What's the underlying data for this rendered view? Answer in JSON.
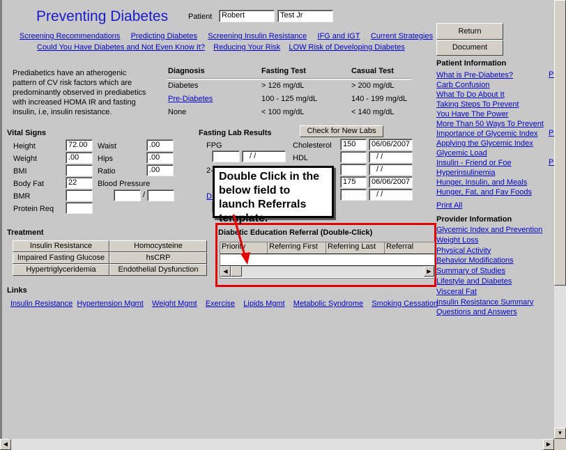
{
  "title": "Preventing Diabetes",
  "patient": {
    "label": "Patient",
    "first": "Robert",
    "last": "Test Jr"
  },
  "top_links_row1": [
    "Screening Recommendations",
    "Predicting Diabetes",
    "Screening Insulin Resistance",
    "IFG and IGT",
    "Current Strategies"
  ],
  "top_links_row2": [
    "Could You Have Diabetes and Not Even Know It?",
    "Reducing Your Risk",
    "LOW Risk of Developing Diabetes"
  ],
  "description": [
    "Prediabetics  have an atherogenic",
    "pattern of CV risk factors which are",
    "predominantly observed in prediabetics",
    "with increased HOMA IR and fasting",
    "insulin, i.e, insulin resistance."
  ],
  "diagnosis_table": {
    "headers": [
      "Diagnosis",
      "Fasting Test",
      "Casual Test"
    ],
    "rows": [
      [
        "Diabetes",
        "> 126 mg/dL",
        "> 200 mg/dL"
      ],
      [
        "Pre-Diabetes",
        "100 - 125 mg/dL",
        "140 - 199 mg/dL"
      ],
      [
        "None",
        "< 100 mg/dL",
        "< 140 mg/dL"
      ]
    ]
  },
  "vitals": {
    "title": "Vital Signs",
    "left": [
      {
        "label": "Height",
        "value": "72.00"
      },
      {
        "label": "Weight",
        "value": ".00"
      },
      {
        "label": "BMI",
        "value": ""
      },
      {
        "label": "Body Fat",
        "value": "22"
      },
      {
        "label": "BMR",
        "value": ""
      },
      {
        "label": "Protein Req",
        "value": ""
      }
    ],
    "right": [
      {
        "label": "Waist",
        "value": ".00"
      },
      {
        "label": "Hips",
        "value": ".00"
      },
      {
        "label": "Ratio",
        "value": ".00"
      }
    ],
    "bp_label": "Blood Pressure",
    "bp_sep": "/"
  },
  "labs": {
    "title": "Fasting Lab Results",
    "check_button": "Check for New Labs",
    "fpg_label": "FPG",
    "fpg_date": " / /",
    "two_label": "2-",
    "dm_link": "DM",
    "right": [
      {
        "label": "Cholesterol",
        "value": "150",
        "date": "06/06/2007"
      },
      {
        "label": "HDL",
        "value": "",
        "date": " / /"
      },
      {
        "label": "",
        "value": "",
        "date": " / /"
      },
      {
        "label": "s",
        "value": "175",
        "date": "06/06/2007"
      },
      {
        "label": "",
        "value": "",
        "date": " / /"
      }
    ]
  },
  "callout": "Double Click in the below field to launch Referrals template.",
  "treatment": {
    "title": "Treatment",
    "buttons": [
      "Insulin Resistance",
      "Homocysteine",
      "Impaired Fasting Glucose",
      "hsCRP",
      "Hypertriglyceridemia",
      "Endothelial Dysfunction"
    ]
  },
  "referral": {
    "title": "Diabetic Education Referral (Double-Click)",
    "columns": [
      "Priority",
      "Referring First",
      "Referring Last",
      "Referral"
    ]
  },
  "links": {
    "title": "Links",
    "items": [
      "Insulin Resistance",
      "Hypertension Mgmt",
      "Weight Mgmt",
      "Exercise",
      "Lipids Mgmt",
      "Metabolic Syndrome",
      "Smoking Cessation"
    ]
  },
  "sidebar": {
    "return": "Return",
    "document": "Document",
    "patient_title": "Patient Information",
    "patient_links": [
      "What is Pre-Diabetes?",
      "Carb Confusion",
      "What To Do About It",
      "Taking Steps To Prevent",
      "You Have The Power",
      "More Than 50 Ways To Prevent",
      "Importance of Glycemic Index",
      "Applying the Glycemic Index",
      "Glycemic Load",
      "Insulin - Friend or Foe",
      "Hyperinsulinemia",
      "Hunger, Insulin, and Meals",
      "Hunger, Fat, and Fav Foods"
    ],
    "print_all": "Print All",
    "cut_link": "Pr",
    "provider_title": "Provider Information",
    "provider_links": [
      "Glycemic Index and Prevention",
      "Weight Loss",
      "Physical Activity",
      "Behavior Modifications",
      "Summary of Studies",
      "Lifestyle and Diabetes",
      "Visceral Fat",
      "Insulin Resistance Summary",
      "Questions and Answers"
    ]
  },
  "colors": {
    "title": "#1a1acc",
    "link": "#0000cc",
    "highlight": "#e00000",
    "background": "#c8c8c8"
  }
}
